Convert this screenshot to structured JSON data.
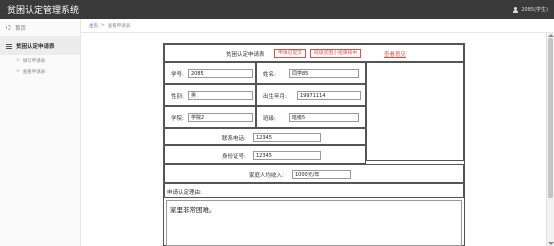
{
  "header": {
    "title": "贫困认定管理系统",
    "user": "2085(学生)"
  },
  "sidebar": {
    "home": "首页",
    "section": "贫困认定申请表",
    "items": [
      {
        "label": "填写申请表"
      },
      {
        "label": "查看申请表"
      }
    ]
  },
  "breadcrumb": {
    "home": "主页",
    "separator": ">",
    "current": "查看申请表"
  },
  "form": {
    "title": "贫困认定申请表",
    "status_submitted": "申请已提交",
    "status_review": "班级贫困小组审核中",
    "view_feedback": "查看意见",
    "student_id_label": "学号:",
    "student_id": "2085",
    "name_label": "姓名:",
    "name": "同学85",
    "gender_label": "性别:",
    "gender": "男",
    "birth_label": "出生年月:",
    "birth": "19971114",
    "college_label": "学院:",
    "college": "学院2",
    "class_label": "班级:",
    "class": "班级5",
    "phone_label": "联系电话:",
    "phone": "12345",
    "id_card_label": "身份证号:",
    "id_card": "12345",
    "income_label": "家庭人均收入:",
    "income": "1000元/年",
    "reason_label": "申请认定理由:",
    "reason": "家里非常困难。"
  }
}
